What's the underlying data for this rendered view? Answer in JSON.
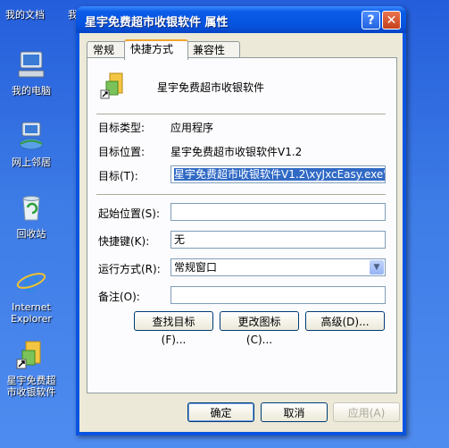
{
  "desktop": {
    "top_labels": [
      "我的文档",
      "我"
    ],
    "icons": [
      {
        "label": "我的电脑",
        "icon": "my-computer-icon"
      },
      {
        "label": "网上邻居",
        "icon": "network-places-icon"
      },
      {
        "label": "回收站",
        "icon": "recycle-bin-icon"
      },
      {
        "label": "Internet Explorer",
        "icon": "internet-explorer-icon"
      },
      {
        "label": "星宇免费超市收银软件",
        "icon": "app-shortcut-icon"
      }
    ]
  },
  "window": {
    "title": "星宇免费超市收银软件 属性",
    "help_glyph": "?",
    "close_glyph": "✕",
    "tabs": [
      "常规",
      "快捷方式",
      "兼容性"
    ],
    "active_tab": "快捷方式",
    "app_name": "星宇免费超市收银软件",
    "target_type_label": "目标类型:",
    "target_type_value": "应用程序",
    "target_location_label": "目标位置:",
    "target_location_value": "星宇免费超市收银软件V1.2",
    "target_label": "目标(T):",
    "target_value": "星宇免费超市收银软件V1.2\\xyJxcEasy.exe\"",
    "start_in_label": "起始位置(S):",
    "start_in_value": "",
    "shortcut_key_label": "快捷键(K):",
    "shortcut_key_value": "无",
    "run_label": "运行方式(R):",
    "run_value": "常规窗口",
    "comment_label": "备注(O):",
    "comment_value": "",
    "find_target_button": "查找目标(F)...",
    "change_icon_button": "更改图标(C)...",
    "advanced_button": "高级(D)...",
    "ok_button": "确定",
    "cancel_button": "取消",
    "apply_button": "应用(A)"
  }
}
